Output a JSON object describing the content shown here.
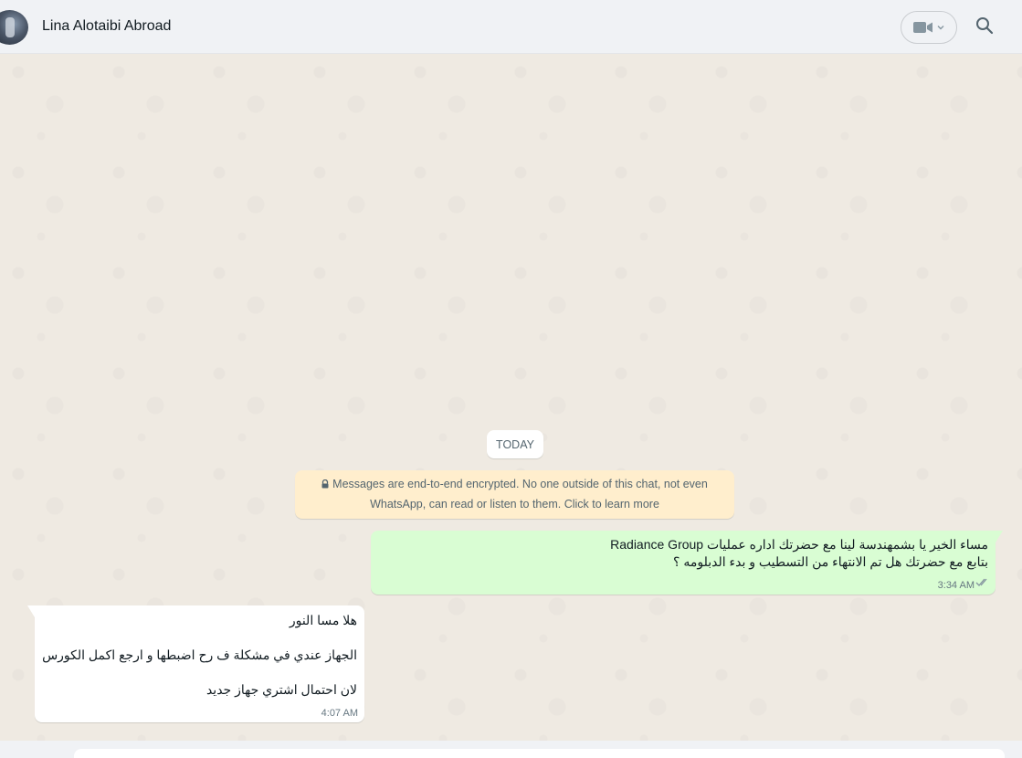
{
  "header": {
    "contact_name": "Lina Alotaibi Abroad",
    "video_icon": "video-camera-icon",
    "search_icon": "search-icon"
  },
  "chat": {
    "date_chip": "TODAY",
    "encryption_notice": {
      "line1": "Messages are end-to-end encrypted. No one outside of this chat, not even",
      "line2": "WhatsApp, can read or listen to them. Click to learn more",
      "icon": "lock-icon"
    },
    "messages": [
      {
        "direction": "outgoing",
        "lines": [
          "مساء الخير يا بشمهندسة لينا مع  حضرتك اداره عمليات Radiance Group",
          "بتابع مع حضرتك هل تم الانتهاء من التسطيب و بدء الدبلومه ؟"
        ],
        "time": "3:34 AM",
        "status": "delivered"
      },
      {
        "direction": "incoming",
        "lines": [
          "هلا مسا النور",
          "الجهاز عندي في مشكلة ف رح اضبطها و ارجع اكمل الكورس",
          "لان احتمال اشتري جهاز جديد"
        ],
        "time": "4:07 AM"
      }
    ]
  },
  "colors": {
    "header_bg": "#f0f2f5",
    "chat_bg": "#efeae2",
    "outgoing_bubble": "#d9fdd3",
    "incoming_bubble": "#ffffff",
    "notice_bg": "#ffeecd"
  }
}
